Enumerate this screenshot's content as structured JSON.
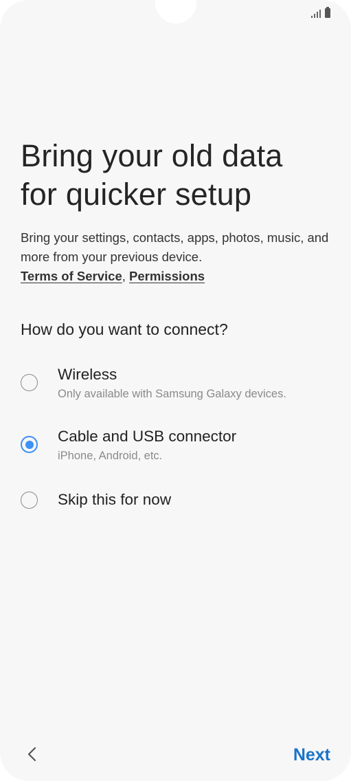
{
  "screen": {
    "title_line1": "Bring your old data",
    "title_line2": "for quicker setup",
    "description": "Bring your settings, contacts, apps, photos, music, and more from your previous device.",
    "terms_link": "Terms of Service",
    "link_separator": ",",
    "permissions_link": "Permissions",
    "question": "How do you want to connect?"
  },
  "options": [
    {
      "title": "Wireless",
      "subtitle": "Only available with Samsung Galaxy devices.",
      "selected": false
    },
    {
      "title": "Cable and USB connector",
      "subtitle": "iPhone, Android, etc.",
      "selected": true
    },
    {
      "title": "Skip this for now",
      "subtitle": "",
      "selected": false
    }
  ],
  "nav": {
    "back_icon": "chevron-left-icon",
    "next_label": "Next"
  },
  "status_bar": {
    "signal_icon": "signal-icon",
    "battery_icon": "battery-icon"
  },
  "colors": {
    "background": "#f7f7f7",
    "accent": "#3e91f5",
    "next": "#1a73c9"
  }
}
